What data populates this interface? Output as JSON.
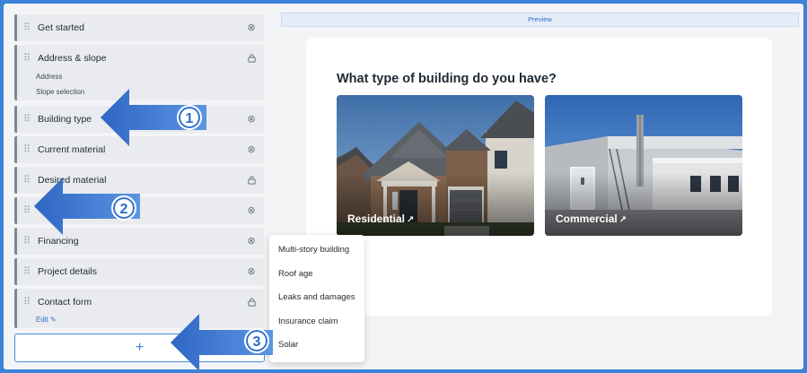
{
  "sidebar": {
    "steps": [
      {
        "label": "Get started",
        "icon": "close-circle-icon"
      },
      {
        "label": "Address & slope",
        "icon": "lock-icon",
        "sub": [
          "Address",
          "Slope selection"
        ]
      },
      {
        "label": "Building type",
        "icon": "close-circle-icon"
      },
      {
        "label": "Current material",
        "icon": "close-circle-icon"
      },
      {
        "label": "Desired material",
        "icon": "lock-icon"
      },
      {
        "label": "",
        "icon": "close-circle-icon"
      },
      {
        "label": "Financing",
        "icon": "close-circle-icon"
      },
      {
        "label": "Project details",
        "icon": "close-circle-icon"
      },
      {
        "label": "Contact form",
        "icon": "lock-icon",
        "edit": "Edit"
      }
    ],
    "add_label": "+"
  },
  "dropdown": {
    "items": [
      "Multi-story building",
      "Roof age",
      "Leaks and damages",
      "Insurance claim",
      "Solar"
    ]
  },
  "preview": {
    "bar_label": "Preview",
    "question": "What type of building do you have?",
    "options": [
      {
        "label": "Residential",
        "arrow": "↗"
      },
      {
        "label": "Commercial",
        "arrow": "↗"
      }
    ]
  },
  "callouts": [
    "1",
    "2",
    "3"
  ],
  "colors": {
    "accent": "#3b82d8",
    "arrow": "#4a7fd4",
    "background": "#f2f4f6"
  }
}
